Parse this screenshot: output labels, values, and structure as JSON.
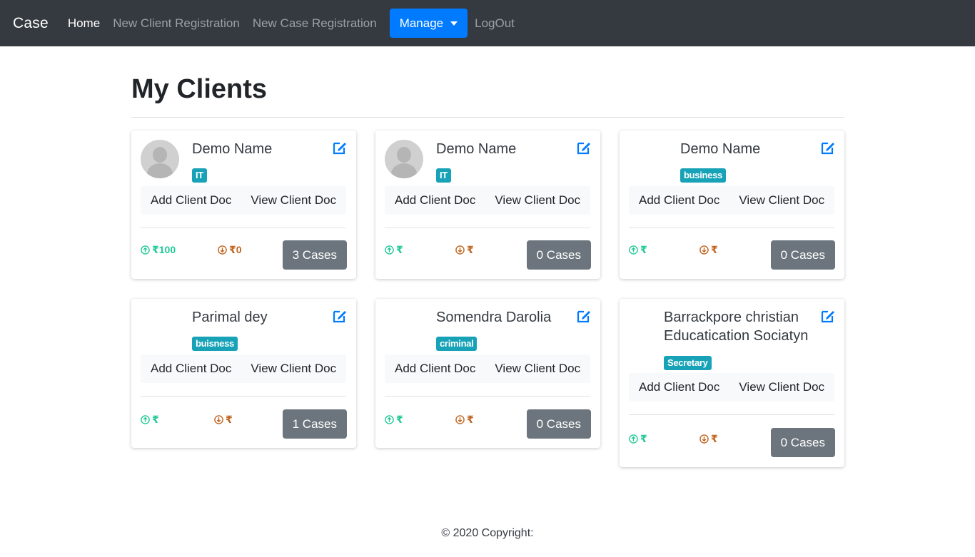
{
  "nav": {
    "brand": "Case",
    "home": "Home",
    "new_client": "New Client Registration",
    "new_case": "New Case Registration",
    "manage": "Manage",
    "logout": "LogOut"
  },
  "page": {
    "title": "My Clients"
  },
  "labels": {
    "add_doc": "Add Client Doc",
    "view_doc": "View Client Doc"
  },
  "cards": [
    {
      "name": "Demo Name",
      "tag": "IT",
      "in": "₹100",
      "out": "₹0",
      "cases": "3 Cases"
    },
    {
      "name": "Demo Name",
      "tag": "IT",
      "in": "₹",
      "out": "₹",
      "cases": "0 Cases"
    },
    {
      "name": "Demo Name",
      "tag": "business",
      "in": "₹",
      "out": "₹",
      "cases": "0 Cases"
    },
    {
      "name": "Parimal dey",
      "tag": "buisness",
      "in": "₹",
      "out": "₹",
      "cases": "1 Cases"
    },
    {
      "name": "Somendra Darolia",
      "tag": "criminal",
      "in": "₹",
      "out": "₹",
      "cases": "0 Cases"
    },
    {
      "name": "Barrackpore christian Educatication Sociatyn",
      "tag": "Secretary",
      "in": "₹",
      "out": "₹",
      "cases": "0 Cases"
    }
  ],
  "footer": {
    "text": "© 2020 Copyright:"
  },
  "colors": {
    "navbar": "#343a40",
    "primary": "#007bff",
    "tag": "#17a2b8",
    "secondary": "#6c757d",
    "income": "#20c997",
    "expense": "#c0641f"
  }
}
